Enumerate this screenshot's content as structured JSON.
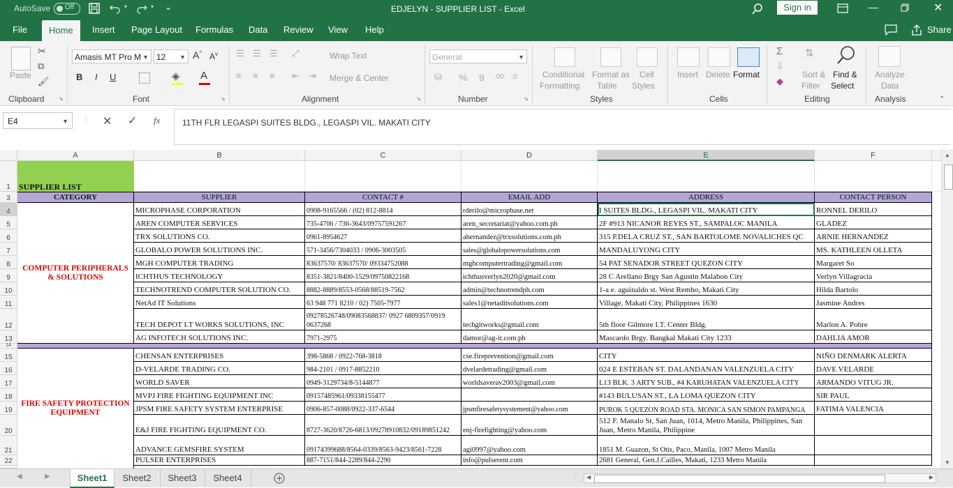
{
  "title_bar": {
    "autosave_label": "AutoSave",
    "autosave_state": "Off",
    "document_title": "EDJELYN - SUPPLIER LIST  -  Excel",
    "sign_in_label": "Sign in"
  },
  "ribbon_tabs": [
    "File",
    "Home",
    "Insert",
    "Page Layout",
    "Formulas",
    "Data",
    "Review",
    "View",
    "Help"
  ],
  "active_tab": "Home",
  "share_label": "Share",
  "ribbon": {
    "clipboard": {
      "paste_label": "Paste",
      "group_label": "Clipboard"
    },
    "font": {
      "font_name": "Amasis MT Pro M",
      "font_size": "12",
      "bold": "B",
      "italic": "I",
      "underline": "U",
      "group_label": "Font"
    },
    "alignment": {
      "wrap_text_label": "Wrap Text",
      "merge_center_label": "Merge & Center",
      "group_label": "Alignment"
    },
    "number": {
      "format_value": "General",
      "percent": "%",
      "comma": "9",
      "group_label": "Number"
    },
    "styles": {
      "conditional_label_1": "Conditional",
      "conditional_label_2": "Formatting",
      "format_table_label_1": "Format as",
      "format_table_label_2": "Table",
      "cell_styles_label_1": "Cell",
      "cell_styles_label_2": "Styles",
      "group_label": "Styles"
    },
    "cells": {
      "insert_label": "Insert",
      "delete_label": "Delete",
      "format_label": "Format",
      "group_label": "Cells"
    },
    "editing": {
      "sort_filter_label_1": "Sort &",
      "sort_filter_label_2": "Filter",
      "find_select_label_1": "Find &",
      "find_select_label_2": "Select",
      "group_label": "Editing"
    },
    "analysis": {
      "analyze_label_1": "Analyze",
      "analyze_label_2": "Data",
      "group_label": "Analysis"
    }
  },
  "formula_bar": {
    "name_box": "E4",
    "fx": "fx",
    "content": "11TH FLR LEGASPI SUITES BLDG., LEGASPI VIL. MAKATI CITY"
  },
  "columns": [
    "A",
    "B",
    "C",
    "D",
    "E",
    "F"
  ],
  "selected_column": "E",
  "row_numbers": [
    "1",
    "3",
    "4",
    "5",
    "6",
    "7",
    "8",
    "9",
    "10",
    "11",
    "12",
    "13",
    "14",
    "15",
    "16",
    "17",
    "18",
    "19",
    "20",
    "21",
    "22"
  ],
  "selected_row": "4",
  "sheet": {
    "title": "SUPPLIER LIST",
    "headers": {
      "category": "CATEGORY",
      "supplier": "SUPPLIER",
      "contact": "CONTACT #",
      "email": "EMAIL ADD",
      "address": "ADDRESS",
      "person": "CONTACT PERSON"
    },
    "categories": [
      {
        "name": "COMPUTER PERIPHERALS & SOLUTIONS"
      },
      {
        "name": "FIRE SAFETY PROTECTION EQUIPMENT"
      }
    ],
    "rows": [
      {
        "supplier": "MICROPHASE CORPORATION",
        "contact": "0908-9165566 / (02) 812-8814",
        "email": "rderilo@microphase.net",
        "address": "I SUITES BLDG., LEGASPI VIL. MAKATI CITY",
        "person": "RONNEL DERILO"
      },
      {
        "supplier": "AREN COMPUTER SERVICES",
        "contact": "735-4706 / 736-3643/09757591267",
        "email": "aren_secretariat@yahoo.com.ph",
        "address": "2F #913 NICANOR REYES ST., SAMPALOC MANILA",
        "person": "GLADEZ"
      },
      {
        "supplier": "TRX SOLUTIONS CO.",
        "contact": "0961-8954627",
        "email": "ahernandez@trxsolutions.com.ph",
        "address": "315 P.DELA CRUZ ST., SAN BARTOLOME NOVALICHES QC",
        "person": "ARNIE HERNANDEZ"
      },
      {
        "supplier": "GLOBALO POWER SOLUTIONS INC.",
        "contact": "571-3456/7304033 / 0906-3003505",
        "email": "sales@globalopowersolutions.com",
        "address": "MANDALUYONG CITY",
        "person": "MS. KATHLEEN OLLETA"
      },
      {
        "supplier": "MGH COMPUTER TRADING",
        "contact": "83637570/ 83637570/ 09334752088",
        "email": "mghcomputertrading@gmail.com",
        "address": "54  PAT SENADOR STREET QUEZON CITY",
        "person": "Margaret So"
      },
      {
        "supplier": "ICHTHUS TECHNOLOGY",
        "contact": "8351-3821/8400-1529/09750822168",
        "email": "ichthusverlyn2020@gmail.com",
        "address": "28 C Arellano Brgy San Agustin Malabon City",
        "person": "Verlyn Villagracia"
      },
      {
        "supplier": "TECHNOTREND COMPUTER SOLUTION CO.",
        "contact": "8882-8889/8553-0568/88519-7562",
        "email": "admin@technotrendph.com",
        "address": "1-a e. aguinaldo st. West Rembo, Makati City",
        "person": "Hilda Bartolo"
      },
      {
        "supplier": "NetAd IT Solutions",
        "contact": "63 948 771 8210 / 02) 7505-7977",
        "email": " sales1@netaditsolutions.com",
        "address": "Village, Makati City, Philippines 1630",
        "person": "Jasmine Andres"
      },
      {
        "supplier": "TECH DEPOT I.T WORKS SOLUTIONS, INC",
        "contact": "09278526748/09083568837/ 0927 6809357/0919 0637268",
        "email": "techgitworks@gmail.com",
        "address": "5th floor Gilmore I.T. Center Bldg.",
        "person": "Marlon A. Pobre"
      },
      {
        "supplier": "AG INFOTECH SOLUTIONS INC.",
        "contact": "7971-2975",
        "email": "damor@ag-it.com.ph",
        "address": "Mascardo Brgy. Bangkal Makati City 1233",
        "person": "DAHLIA AMOR"
      },
      {
        "supplier": "CHENSAN ENTERPRISES",
        "contact": "398-5868 / 0922-768-3818",
        "email": "cse.fireprevention@gmail.com",
        "address": "CITY",
        "person": "NIÑO DENMARK ALERTA"
      },
      {
        "supplier": "D-VELARDE TRADING CO.",
        "contact": "984-2101 / 0917-8852210",
        "email": "dvelardetrading@gmail.com",
        "address": "024 E ESTEBAN ST. DALANDANAN VALENZUELA CITY",
        "person": "DAVE VELARDE"
      },
      {
        "supplier": "WORLD SAVER",
        "contact": "0949-3129734/8-5144877",
        "email": "worldsaverav2003@gmail.com",
        "address": "L13 BLK. 3 ARTY SUB., #4 KARUHATAN VALENZUELA CITY",
        "person": "ARMANDO VITUG JR."
      },
      {
        "supplier": "MVPJ FIRE FIGHTING EQUIPMENT INC",
        "contact": "09157485961/09338155477",
        "email": "",
        "address": "#143 BULUSAN ST., LA LOMA QUEZON CITY",
        "person": "SIR PAUL"
      },
      {
        "supplier": "JPSM FIRE SAFETY SYSTEM ENTERPRISE",
        "contact": "0906-857-0088/0922-337-6544",
        "email": "jpsmfiresafetysystement@yahoo.com",
        "address": "PUROK 5 QUEZON ROAD STA. MONICA SAN SIMON PAMPANGA",
        "person": "FATIMA VALENCIA"
      },
      {
        "supplier": "E&J FIRE FIGHTING EQUIPMENT CO.",
        "contact": "8727-3620/8726-6813/09278910832/09189851242",
        "email": "enj-firefighting@yahoo.com",
        "address": "512 F. Manalo St, San Juan, 1014, Metro Manila, Philippines, San Juan, Metro Manila, Philippine",
        "person": ""
      },
      {
        "supplier": "ADVANCE GEMSFIRE SYSTEM",
        "contact": "09174399688/8564-0339/8563-9423/8561-7228",
        "email": "agi0997@yahoo.com",
        "address": "1851 M. Guazon, St Otis, Paco, Manila, 1007 Metro Manila",
        "person": ""
      },
      {
        "supplier": "PULSER ENTERPRISES",
        "contact": "887-7151/844-2289/844-2290",
        "email": "info@pulserent.com",
        "address": "2681 General, Gen.J.Cailles, Makati, 1233 Metro Manila",
        "person": ""
      }
    ]
  },
  "sheet_tabs": [
    "Sheet1",
    "Sheet2",
    "Sheet3",
    "Sheet4"
  ],
  "active_sheet": "Sheet1",
  "colors": {
    "excel_green": "#217346",
    "header_fill": "#b4a7d6",
    "title_fill": "#92d050",
    "category_text": "#e00000"
  }
}
